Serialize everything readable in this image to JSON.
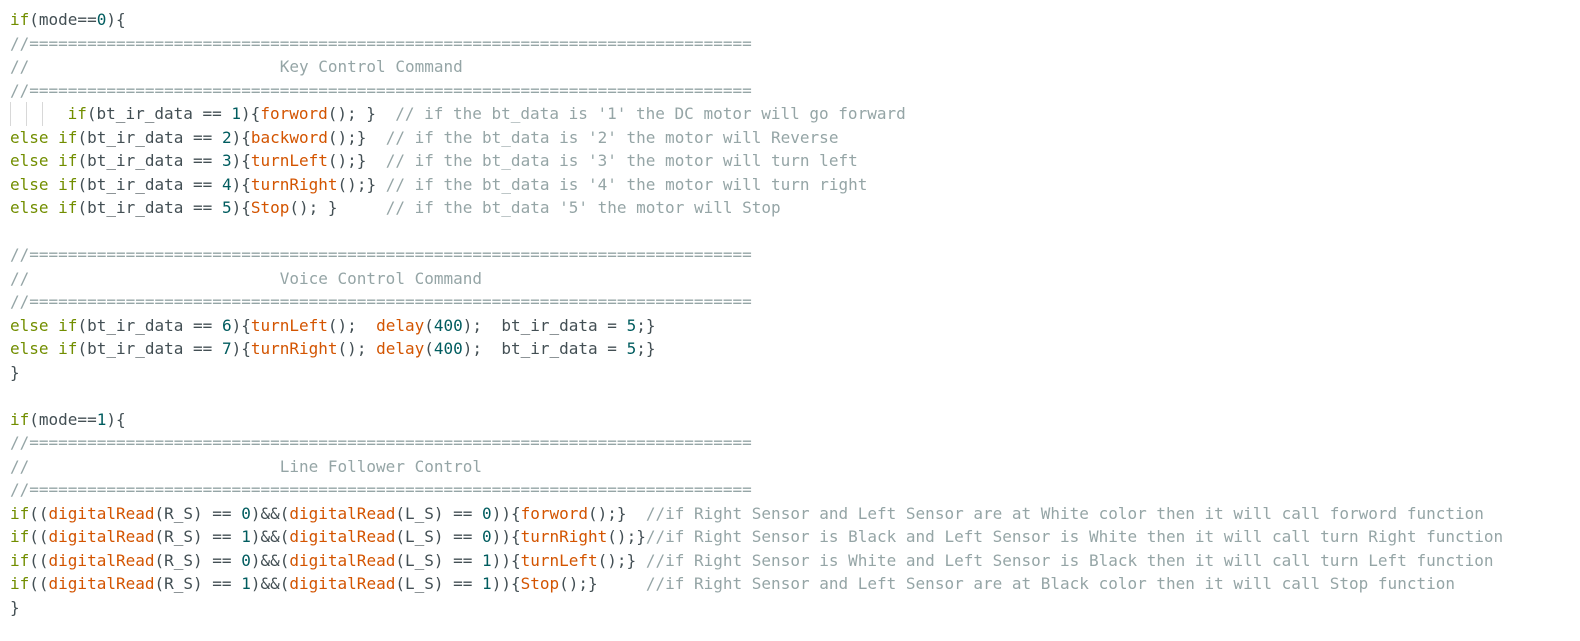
{
  "editor": {
    "lines": [
      [
        {
          "t": "kw",
          "v": "if"
        },
        {
          "t": "plain",
          "v": "(mode=="
        },
        {
          "t": "num",
          "v": "0"
        },
        {
          "t": "plain",
          "v": "){"
        }
      ],
      [
        {
          "t": "cmt",
          "v": "//==========================================================================="
        }
      ],
      [
        {
          "t": "cmt",
          "v": "//                          Key Control Command"
        }
      ],
      [
        {
          "t": "cmt",
          "v": "//==========================================================================="
        }
      ],
      [
        {
          "t": "guide",
          "v": "3"
        },
        {
          "t": "plain",
          "v": " "
        },
        {
          "t": "kw",
          "v": "if"
        },
        {
          "t": "plain",
          "v": "(bt_ir_data == "
        },
        {
          "t": "num",
          "v": "1"
        },
        {
          "t": "plain",
          "v": "){"
        },
        {
          "t": "fn",
          "v": "forword"
        },
        {
          "t": "plain",
          "v": "(); }  "
        },
        {
          "t": "cmt",
          "v": "// if the bt_data is '1' the DC motor will go forward"
        }
      ],
      [
        {
          "t": "kw",
          "v": "else if"
        },
        {
          "t": "plain",
          "v": "(bt_ir_data == "
        },
        {
          "t": "num",
          "v": "2"
        },
        {
          "t": "plain",
          "v": "){"
        },
        {
          "t": "fn",
          "v": "backword"
        },
        {
          "t": "plain",
          "v": "();}  "
        },
        {
          "t": "cmt",
          "v": "// if the bt_data is '2' the motor will Reverse"
        }
      ],
      [
        {
          "t": "kw",
          "v": "else if"
        },
        {
          "t": "plain",
          "v": "(bt_ir_data == "
        },
        {
          "t": "num",
          "v": "3"
        },
        {
          "t": "plain",
          "v": "){"
        },
        {
          "t": "fn",
          "v": "turnLeft"
        },
        {
          "t": "plain",
          "v": "();}  "
        },
        {
          "t": "cmt",
          "v": "// if the bt_data is '3' the motor will turn left"
        }
      ],
      [
        {
          "t": "kw",
          "v": "else if"
        },
        {
          "t": "plain",
          "v": "(bt_ir_data == "
        },
        {
          "t": "num",
          "v": "4"
        },
        {
          "t": "plain",
          "v": "){"
        },
        {
          "t": "fn",
          "v": "turnRight"
        },
        {
          "t": "plain",
          "v": "();} "
        },
        {
          "t": "cmt",
          "v": "// if the bt_data is '4' the motor will turn right"
        }
      ],
      [
        {
          "t": "kw",
          "v": "else if"
        },
        {
          "t": "plain",
          "v": "(bt_ir_data == "
        },
        {
          "t": "num",
          "v": "5"
        },
        {
          "t": "plain",
          "v": "){"
        },
        {
          "t": "fn",
          "v": "Stop"
        },
        {
          "t": "plain",
          "v": "(); }     "
        },
        {
          "t": "cmt",
          "v": "// if the bt_data '5' the motor will Stop"
        }
      ],
      [],
      [
        {
          "t": "cmt",
          "v": "//==========================================================================="
        }
      ],
      [
        {
          "t": "cmt",
          "v": "//                          Voice Control Command"
        }
      ],
      [
        {
          "t": "cmt",
          "v": "//==========================================================================="
        }
      ],
      [
        {
          "t": "kw",
          "v": "else if"
        },
        {
          "t": "plain",
          "v": "(bt_ir_data == "
        },
        {
          "t": "num",
          "v": "6"
        },
        {
          "t": "plain",
          "v": "){"
        },
        {
          "t": "fn",
          "v": "turnLeft"
        },
        {
          "t": "plain",
          "v": "();  "
        },
        {
          "t": "fn",
          "v": "delay"
        },
        {
          "t": "plain",
          "v": "("
        },
        {
          "t": "num",
          "v": "400"
        },
        {
          "t": "plain",
          "v": ");  bt_ir_data = "
        },
        {
          "t": "num",
          "v": "5"
        },
        {
          "t": "plain",
          "v": ";}"
        }
      ],
      [
        {
          "t": "kw",
          "v": "else if"
        },
        {
          "t": "plain",
          "v": "(bt_ir_data == "
        },
        {
          "t": "num",
          "v": "7"
        },
        {
          "t": "plain",
          "v": "){"
        },
        {
          "t": "fn",
          "v": "turnRight"
        },
        {
          "t": "plain",
          "v": "(); "
        },
        {
          "t": "fn",
          "v": "delay"
        },
        {
          "t": "plain",
          "v": "("
        },
        {
          "t": "num",
          "v": "400"
        },
        {
          "t": "plain",
          "v": ");  bt_ir_data = "
        },
        {
          "t": "num",
          "v": "5"
        },
        {
          "t": "plain",
          "v": ";}"
        }
      ],
      [
        {
          "t": "plain",
          "v": "}"
        }
      ],
      [],
      [
        {
          "t": "kw",
          "v": "if"
        },
        {
          "t": "plain",
          "v": "(mode=="
        },
        {
          "t": "num",
          "v": "1"
        },
        {
          "t": "plain",
          "v": "){"
        }
      ],
      [
        {
          "t": "cmt",
          "v": "//==========================================================================="
        }
      ],
      [
        {
          "t": "cmt",
          "v": "//                          Line Follower Control"
        }
      ],
      [
        {
          "t": "cmt",
          "v": "//==========================================================================="
        }
      ],
      [
        {
          "t": "kw",
          "v": "if"
        },
        {
          "t": "plain",
          "v": "(("
        },
        {
          "t": "fn",
          "v": "digitalRead"
        },
        {
          "t": "plain",
          "v": "(R_S) == "
        },
        {
          "t": "num",
          "v": "0"
        },
        {
          "t": "plain",
          "v": ")&&("
        },
        {
          "t": "fn",
          "v": "digitalRead"
        },
        {
          "t": "plain",
          "v": "(L_S) == "
        },
        {
          "t": "num",
          "v": "0"
        },
        {
          "t": "plain",
          "v": ")){"
        },
        {
          "t": "fn",
          "v": "forword"
        },
        {
          "t": "plain",
          "v": "();}  "
        },
        {
          "t": "cmt",
          "v": "//if Right Sensor and Left Sensor are at White color then it will call forword function"
        }
      ],
      [
        {
          "t": "kw",
          "v": "if"
        },
        {
          "t": "plain",
          "v": "(("
        },
        {
          "t": "fn",
          "v": "digitalRead"
        },
        {
          "t": "plain",
          "v": "(R_S) == "
        },
        {
          "t": "num",
          "v": "1"
        },
        {
          "t": "plain",
          "v": ")&&("
        },
        {
          "t": "fn",
          "v": "digitalRead"
        },
        {
          "t": "plain",
          "v": "(L_S) == "
        },
        {
          "t": "num",
          "v": "0"
        },
        {
          "t": "plain",
          "v": ")){"
        },
        {
          "t": "fn",
          "v": "turnRight"
        },
        {
          "t": "plain",
          "v": "();}"
        },
        {
          "t": "cmt",
          "v": "//if Right Sensor is Black and Left Sensor is White then it will call turn Right function"
        }
      ],
      [
        {
          "t": "kw",
          "v": "if"
        },
        {
          "t": "plain",
          "v": "(("
        },
        {
          "t": "fn",
          "v": "digitalRead"
        },
        {
          "t": "plain",
          "v": "(R_S) == "
        },
        {
          "t": "num",
          "v": "0"
        },
        {
          "t": "plain",
          "v": ")&&("
        },
        {
          "t": "fn",
          "v": "digitalRead"
        },
        {
          "t": "plain",
          "v": "(L_S) == "
        },
        {
          "t": "num",
          "v": "1"
        },
        {
          "t": "plain",
          "v": ")){"
        },
        {
          "t": "fn",
          "v": "turnLeft"
        },
        {
          "t": "plain",
          "v": "();} "
        },
        {
          "t": "cmt",
          "v": "//if Right Sensor is White and Left Sensor is Black then it will call turn Left function"
        }
      ],
      [
        {
          "t": "kw",
          "v": "if"
        },
        {
          "t": "plain",
          "v": "(("
        },
        {
          "t": "fn",
          "v": "digitalRead"
        },
        {
          "t": "plain",
          "v": "(R_S) == "
        },
        {
          "t": "num",
          "v": "1"
        },
        {
          "t": "plain",
          "v": ")&&("
        },
        {
          "t": "fn",
          "v": "digitalRead"
        },
        {
          "t": "plain",
          "v": "(L_S) == "
        },
        {
          "t": "num",
          "v": "1"
        },
        {
          "t": "plain",
          "v": ")){"
        },
        {
          "t": "fn",
          "v": "Stop"
        },
        {
          "t": "plain",
          "v": "();}     "
        },
        {
          "t": "cmt",
          "v": "//if Right Sensor and Left Sensor are at Black color then it will call Stop function"
        }
      ],
      [
        {
          "t": "plain",
          "v": "}"
        }
      ]
    ]
  },
  "colors": {
    "keyword": "#728e00",
    "function": "#d35400",
    "number": "#005c5f",
    "comment": "#95a5a6",
    "plain": "#434f54",
    "background": "#ffffff"
  }
}
